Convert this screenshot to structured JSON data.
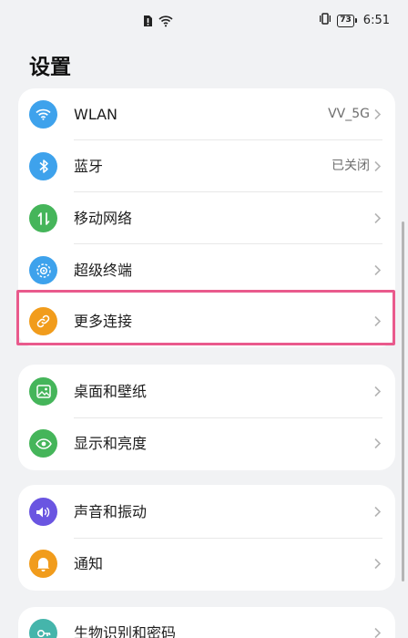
{
  "status_bar": {
    "time": "6:51",
    "battery": "73",
    "icons": [
      "sim-alert-icon",
      "wifi-icon",
      "vibrate-icon",
      "battery-icon"
    ]
  },
  "page": {
    "title": "设置"
  },
  "sections": [
    {
      "items": [
        {
          "label": "WLAN",
          "value": "VV_5G",
          "icon": "wifi-icon",
          "color": "#3ea2ec"
        },
        {
          "label": "蓝牙",
          "value": "已关闭",
          "icon": "bluetooth-icon",
          "color": "#3ea2ec"
        },
        {
          "label": "移动网络",
          "value": "",
          "icon": "mobile-data-icon",
          "color": "#45b55a"
        },
        {
          "label": "超级终端",
          "value": "",
          "icon": "super-device-icon",
          "color": "#3ea2ec"
        },
        {
          "label": "更多连接",
          "value": "",
          "icon": "link-icon",
          "color": "#f19c1c"
        }
      ]
    },
    {
      "items": [
        {
          "label": "桌面和壁纸",
          "value": "",
          "icon": "wallpaper-icon",
          "color": "#45b55a"
        },
        {
          "label": "显示和亮度",
          "value": "",
          "icon": "eye-icon",
          "color": "#45b55a"
        }
      ]
    },
    {
      "items": [
        {
          "label": "声音和振动",
          "value": "",
          "icon": "speaker-icon",
          "color": "#6a55e1"
        },
        {
          "label": "通知",
          "value": "",
          "icon": "bell-icon",
          "color": "#f19c1c"
        }
      ]
    },
    {
      "items": [
        {
          "label": "生物识别和密码",
          "value": "",
          "icon": "key-icon",
          "color": "#45b5ab"
        }
      ]
    }
  ],
  "highlight": {
    "target": "更多连接",
    "color": "#e95a8c"
  }
}
